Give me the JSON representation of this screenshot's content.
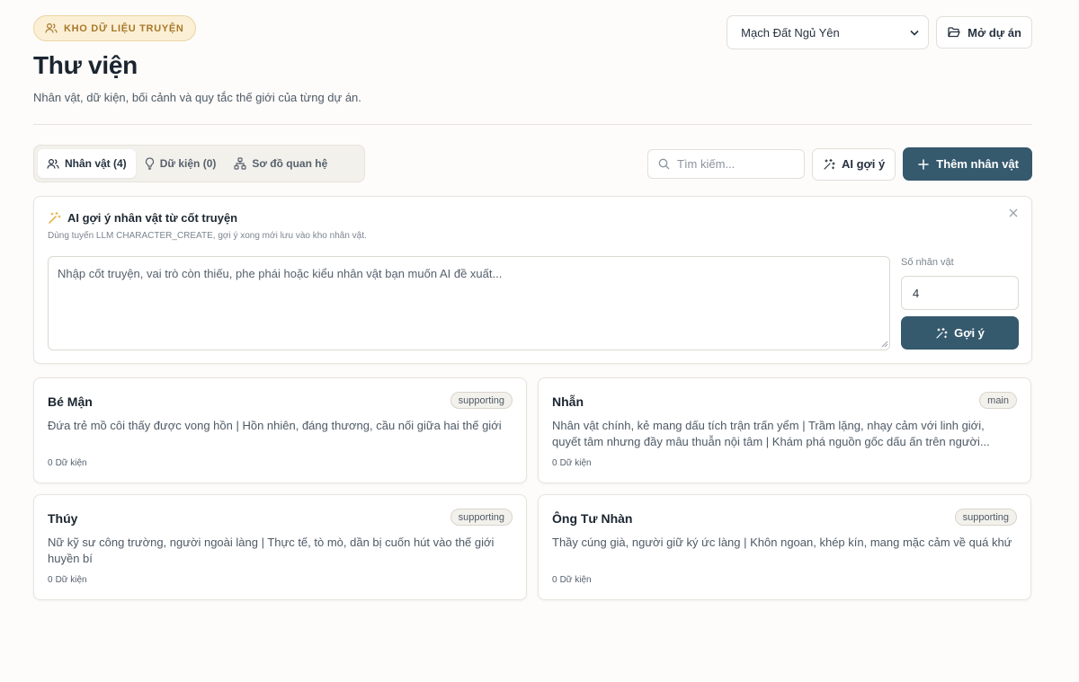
{
  "header": {
    "section_badge": "KHO DỮ LIỆU TRUYỆN",
    "title": "Thư viện",
    "subtitle": "Nhân vật, dữ kiện, bối cảnh và quy tắc thế giới của từng dự án.",
    "project_select": {
      "selected": "Mạch Đất Ngủ Yên"
    },
    "open_project_label": "Mở dự án"
  },
  "tabs": [
    {
      "label": "Nhân vật (4)",
      "icon": "users-icon",
      "active": true
    },
    {
      "label": "Dữ kiện (0)",
      "icon": "lightbulb-icon",
      "active": false
    },
    {
      "label": "Sơ đồ quan hệ",
      "icon": "network-icon",
      "active": false
    }
  ],
  "toolbar": {
    "search_placeholder": "Tìm kiếm...",
    "ai_suggest_label": "AI gợi ý",
    "add_character_label": "Thêm nhân vật"
  },
  "ai_panel": {
    "title": "AI gợi ý nhân vật từ cốt truyện",
    "description": "Dùng tuyến LLM CHARACTER_CREATE, gợi ý xong mới lưu vào kho nhân vật.",
    "textarea_placeholder": "Nhập cốt truyện, vai trò còn thiếu, phe phái hoặc kiểu nhân vật bạn muốn AI đề xuất...",
    "count_label": "Số nhân vật",
    "count_value": "4",
    "suggest_button_label": "Gợi ý"
  },
  "characters": [
    {
      "name": "Bé Mận",
      "role": "supporting",
      "description": "Đứa trẻ mồ côi thấy được vong hồn | Hồn nhiên, đáng thương, cầu nối giữa hai thế giới",
      "facts_count": "0",
      "facts_label": "Dữ kiện"
    },
    {
      "name": "Nhẫn",
      "role": "main",
      "description": "Nhân vật chính, kẻ mang dấu tích trận trấn yểm | Trầm lặng, nhạy cảm với linh giới, quyết tâm nhưng đầy mâu thuẫn nội tâm | Khám phá nguồn gốc dấu ấn trên người...",
      "facts_count": "0",
      "facts_label": "Dữ kiện"
    },
    {
      "name": "Thúy",
      "role": "supporting",
      "description": "Nữ kỹ sư công trường, người ngoài làng | Thực tế, tò mò, dần bị cuốn hút vào thế giới huyền bí",
      "facts_count": "0",
      "facts_label": "Dữ kiện"
    },
    {
      "name": "Ông Tư Nhàn",
      "role": "supporting",
      "description": "Thầy cúng già, người giữ ký ức làng | Khôn ngoan, khép kín, mang mặc cảm về quá khứ",
      "facts_count": "0",
      "facts_label": "Dữ kiện"
    }
  ],
  "colors": {
    "primary": "#35596d",
    "badge_bg": "#fbf0d6",
    "badge_text": "#a8772a",
    "page_bg": "#fdfcfa"
  }
}
